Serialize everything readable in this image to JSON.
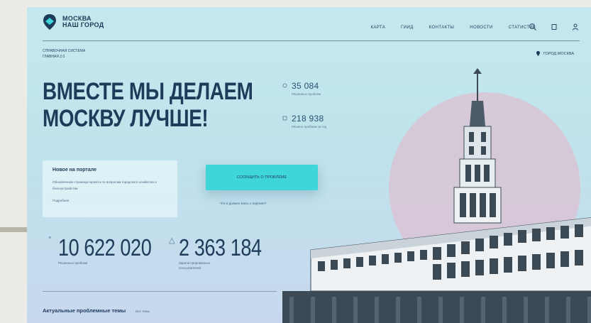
{
  "logo": {
    "line1": "МОСКВА",
    "line2": "НАШ ГОРОД"
  },
  "nav": {
    "items": [
      "КАРТА",
      "ГИИД",
      "КОНТАКТЫ",
      "НОВОСТИ",
      "СТАТИСТИК"
    ]
  },
  "breadcrumb": {
    "line1": "СПРАВОЧНАЯ СИСТЕМА",
    "line2": "ГЛАВНАЯ 2.0"
  },
  "city": {
    "label": "ГОРОД МОСКВА"
  },
  "hero": {
    "title_line1": "ВМЕСТЕ МЫ ДЕЛАЕМ",
    "title_line2": "МОСКВУ ЛУЧШЕ!"
  },
  "small_stats": [
    {
      "value": "35 084",
      "caption": "Решенных проблем"
    },
    {
      "value": "218 938",
      "caption": "Решено проблем за год"
    }
  ],
  "news": {
    "title": "Новое на портале",
    "text": "Обновленная страница проекта по вопросам городского хозяйства и благоустройства",
    "link": "Подробнее"
  },
  "cta": {
    "label": "СООБЩИТЬ О ПРОБЛЕМЕ",
    "sub": "Что я должен знать о портале?"
  },
  "big_stats": [
    {
      "value": "10 622 020",
      "caption": "Решенных проблем"
    },
    {
      "value": "2 363 184",
      "caption": "Зарегистрированных пользователей"
    }
  ],
  "topics": {
    "title": "Актуальные проблемные темы",
    "link": "Все темы"
  },
  "colors": {
    "accent": "#3fd6d9",
    "dark": "#1f3b5a",
    "disk": "#d9c4d4",
    "building": "#3b4a55"
  },
  "icons": [
    "logo-pin-icon",
    "search-icon",
    "bookmark-icon",
    "user-icon",
    "location-pin-icon"
  ]
}
